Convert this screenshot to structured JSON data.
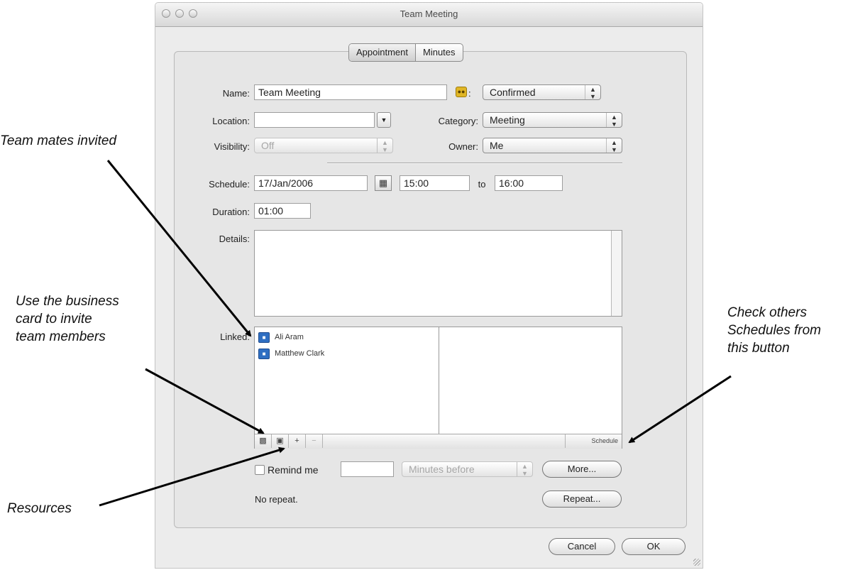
{
  "window": {
    "title": "Team Meeting"
  },
  "tabs": [
    {
      "label": "Appointment",
      "selected": true
    },
    {
      "label": "Minutes",
      "selected": false
    }
  ],
  "form": {
    "name_label": "Name:",
    "name_value": "Team Meeting",
    "status_sep": ":",
    "status_value": "Confirmed",
    "location_label": "Location:",
    "location_value": "",
    "category_label": "Category:",
    "category_value": "Meeting",
    "visibility_label": "Visibility:",
    "visibility_value": "Off",
    "owner_label": "Owner:",
    "owner_value": "Me",
    "schedule_label": "Schedule:",
    "date_value": "17/Jan/2006",
    "start_value": "15:00",
    "to_label": "to",
    "end_value": "16:00",
    "duration_label": "Duration:",
    "duration_value": "01:00",
    "details_label": "Details:",
    "details_value": "",
    "linked_label": "Linked:",
    "linked_items": [
      {
        "name": "Ali Aram"
      },
      {
        "name": "Matthew Clark"
      }
    ],
    "linked_toolbar": {
      "add": "+",
      "remove": "−",
      "schedule": "Schedule"
    },
    "remind_label": "Remind me",
    "remind_value": "",
    "remind_unit": "Minutes before",
    "more_label": "More...",
    "repeat_status": "No repeat.",
    "repeat_label": "Repeat..."
  },
  "buttons": {
    "cancel": "Cancel",
    "ok": "OK"
  },
  "annotations": {
    "team_mates": "Team mates invited",
    "business_card": [
      "Use the business",
      "card to invite",
      "team members"
    ],
    "check_others": [
      "Check others",
      "Schedules from",
      "this button"
    ],
    "resources": "Resources"
  }
}
